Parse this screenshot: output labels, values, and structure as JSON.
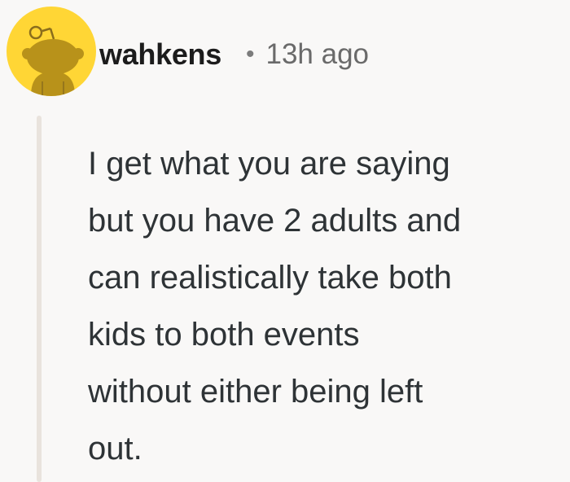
{
  "comment": {
    "author": "wahkens",
    "separator": "•",
    "timestamp": "13h ago",
    "avatar_icon": "snoo-avatar-icon",
    "avatar_color": "#ffd635",
    "body": "I get what you are saying\nbut you have 2 adults and\ncan realistically take both\nkids to both events\nwithout either being left\nout."
  }
}
